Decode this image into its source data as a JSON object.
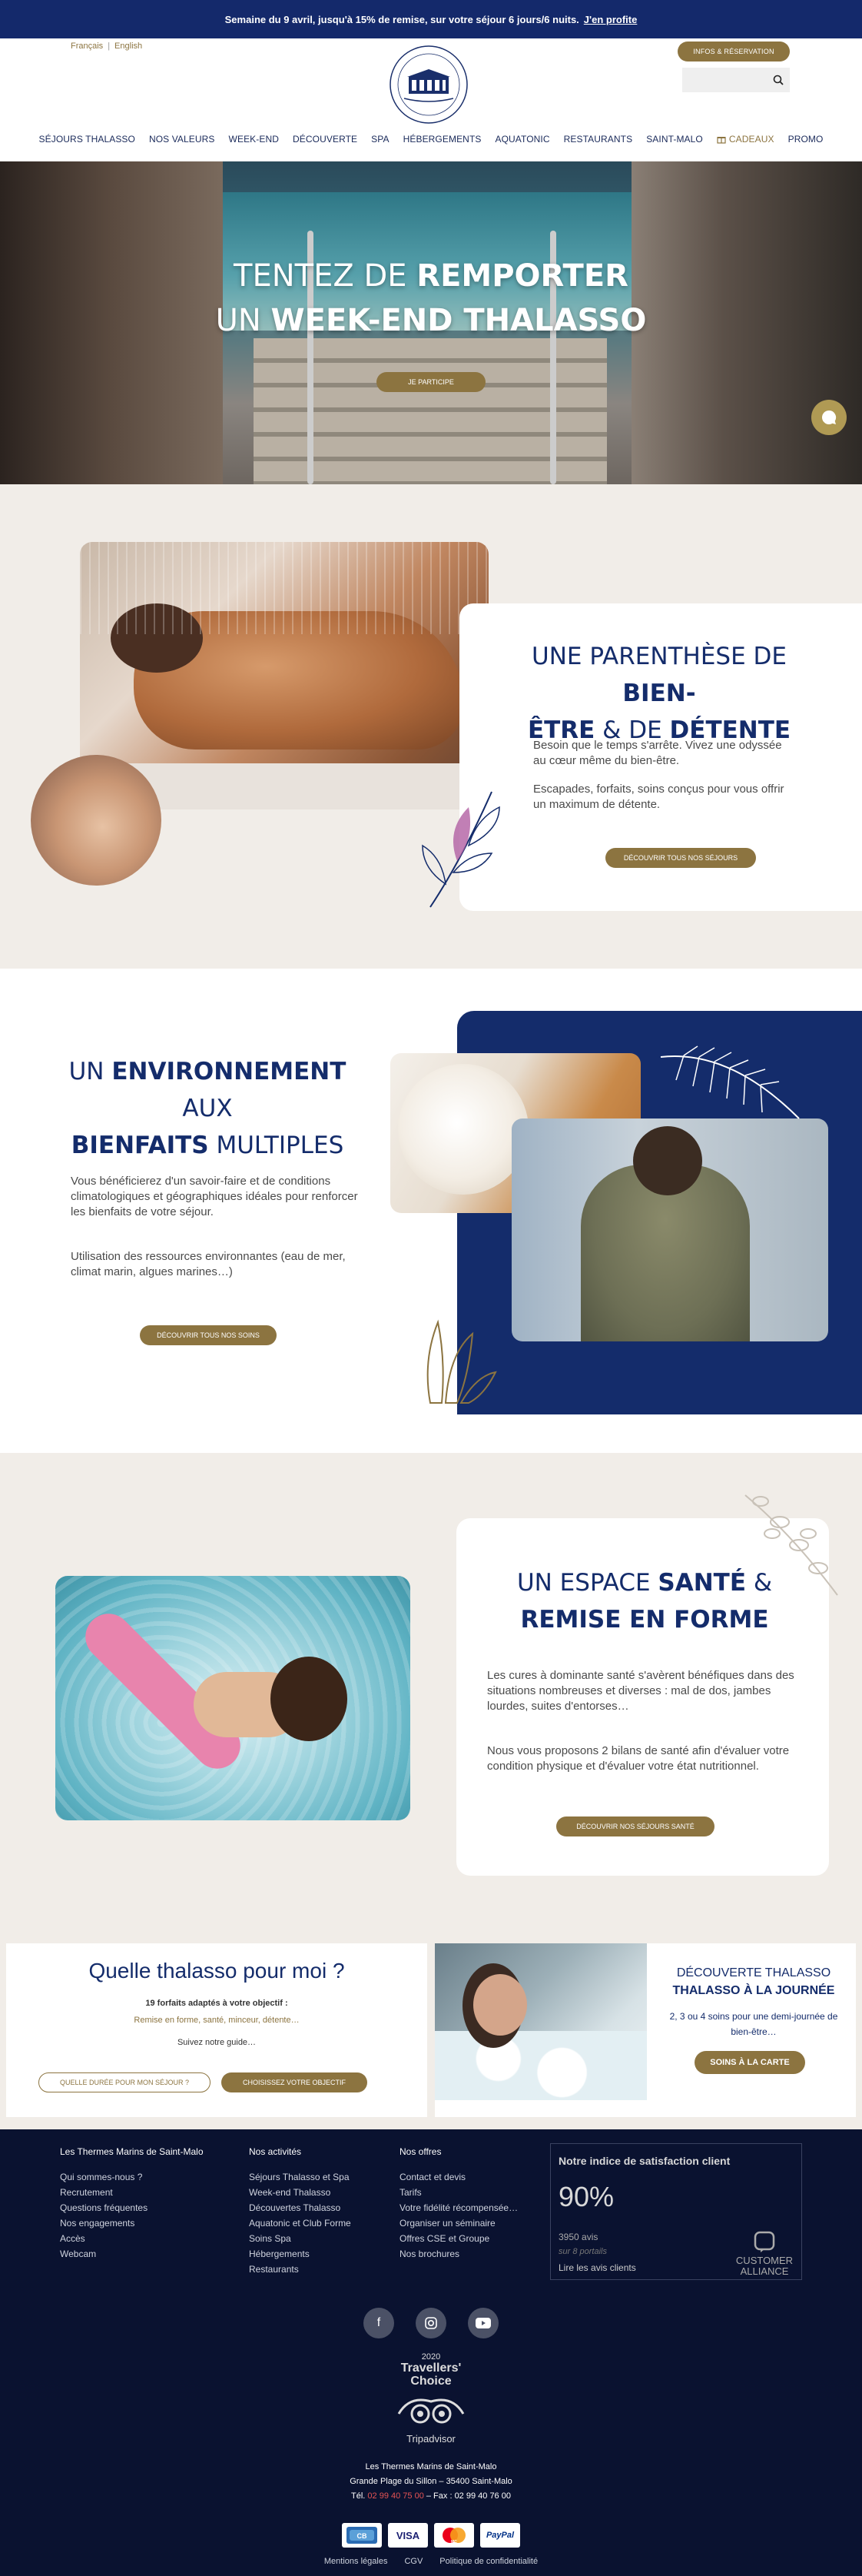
{
  "topbar": {
    "text": "Semaine du 9 avril, jusqu'à 15% de remise, sur votre séjour 6 jours/6 nuits.",
    "cta": "J'en profite"
  },
  "header": {
    "lang_fr": "Français",
    "lang_sep": "|",
    "lang_en": "English",
    "info_button": "INFOS & RÉSERVATION",
    "search_placeholder": "",
    "nav": [
      "SÉJOURS THALASSO",
      "NOS VALEURS",
      "WEEK-END",
      "DÉCOUVERTE",
      "SPA",
      "HÉBERGEMENTS",
      "AQUATONIC",
      "RESTAURANTS",
      "SAINT-MALO"
    ],
    "nav_gift": "CADEAUX",
    "nav_promo": "PROMO"
  },
  "hero": {
    "line1a": "TENTEZ DE ",
    "line1b": "REMPORTER",
    "line2a": "UN ",
    "line2b": "WEEK-END THALASSO",
    "button": "JE PARTICIPE"
  },
  "section1": {
    "t1": "UNE PARENTHÈSE DE ",
    "t2": "BIEN-",
    "t3": "ÊTRE",
    "t4": " & DE ",
    "t5": "DÉTENTE",
    "p1": "Besoin que le temps s'arrête. Vivez une odyssée au cœur même du bien-être.",
    "p2": "Escapades, forfaits, soins conçus pour vous offrir un maximum de détente.",
    "button": "DÉCOUVRIR TOUS NOS SÉJOURS"
  },
  "section2": {
    "t1": "UN ",
    "t2": "ENVIRONNEMENT",
    "t3": " AUX",
    "t4": "BIENFAITS",
    "t5": " MULTIPLES",
    "p1": "Vous bénéficierez d'un savoir-faire et de conditions climatologiques et géographiques idéales pour renforcer les bienfaits de votre séjour.",
    "p2": "Utilisation des ressources environnantes (eau de mer, climat marin, algues marines…)",
    "button": "DÉCOUVRIR TOUS NOS SOINS"
  },
  "section3": {
    "t1": "UN ESPACE ",
    "t2": "SANTÉ",
    "t3": " &",
    "t4": "REMISE EN FORME",
    "p1": "Les cures à dominante santé s'avèrent bénéfiques dans des situations nombreuses et diverses : mal de dos, jambes lourdes, suites d'entorses…",
    "p2": "Nous vous proposons 2 bilans de santé afin d'évaluer votre condition physique et d'évaluer votre état nutritionnel.",
    "button": "DÉCOUVRIR NOS SÉJOURS SANTÉ"
  },
  "quiz": {
    "title": "Quelle thalasso pour moi ?",
    "subtitle": "19 forfaits adaptés à votre objectif :",
    "categories": "Remise en forme,  santé, minceur,  détente…",
    "guide": "Suivez notre guide…",
    "button1": "QUELLE DURÉE POUR MON SÉJOUR ?",
    "button2": "CHOISISSEZ VOTRE OBJECTIF"
  },
  "discovery": {
    "title": "DÉCOUVERTE THALASSO",
    "title_bold": "THALASSO À LA JOURNÉE",
    "text": "2, 3 ou 4 soins pour une demi-journée de bien-être…",
    "button": "SOINS À LA CARTE"
  },
  "footer": {
    "col1": {
      "title": "Les Thermes Marins de Saint-Malo",
      "links": [
        "Qui sommes-nous ?",
        "Recrutement",
        "Questions fréquentes",
        "Nos engagements",
        "Accès",
        "Webcam"
      ]
    },
    "col2": {
      "title": "Nos activités",
      "links": [
        "Séjours Thalasso et Spa",
        "Week-end Thalasso",
        "Découvertes Thalasso",
        "Aquatonic et Club Forme",
        "Soins Spa",
        "Hébergements",
        "Restaurants"
      ]
    },
    "col3": {
      "title": "Nos offres",
      "links": [
        "Contact et devis",
        "Tarifs",
        "Votre fidélité récompensée…",
        "Organiser un séminaire",
        "Offres CSE et Groupe",
        "Nos brochures"
      ]
    },
    "satisfaction": {
      "title": "Notre indice de satisfaction client",
      "percent": "90%",
      "reviews": "3950 avis",
      "portals": "sur 8 portails",
      "read": "Lire les avis clients",
      "badge1": "CUSTOMER",
      "badge2": "ALLIANCE"
    },
    "tripadvisor": {
      "year": "2020",
      "line1": "Travellers'",
      "line2": "Choice",
      "brand": "Tripadvisor"
    },
    "address": {
      "name": "Les Thermes Marins de Saint-Malo",
      "street": "Grande Plage du Sillon – 35400 Saint-Malo",
      "tel_label": "Tél. ",
      "tel": "02 99 40 75 00",
      "fax": " – Fax : 02 99 40 76 00"
    },
    "payments": [
      "CB",
      "VISA",
      "MC",
      "PayPal"
    ],
    "legal": [
      "Mentions légales",
      "CGV",
      "Politique de confidentialité"
    ]
  }
}
